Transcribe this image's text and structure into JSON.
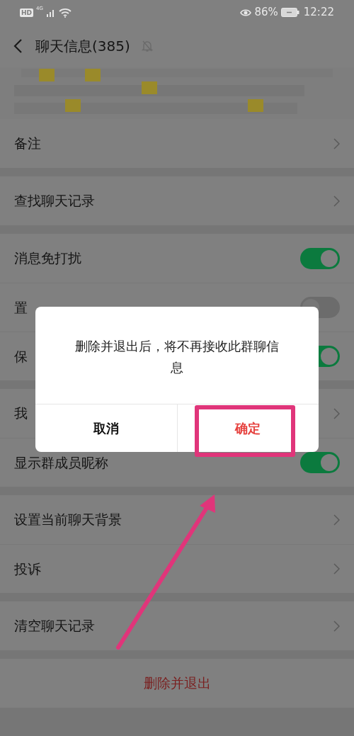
{
  "status_bar": {
    "hd_badge": "HD",
    "network": "4G",
    "battery": "86%",
    "time": "12:22"
  },
  "header": {
    "title": "聊天信息(385)",
    "muted": true
  },
  "members": {
    "kind": "picture"
  },
  "groups": [
    [
      {
        "kind": "link",
        "label": "备注"
      }
    ],
    [
      {
        "kind": "link",
        "label": "查找聊天记录"
      }
    ],
    [
      {
        "kind": "toggle",
        "label": "消息免打扰",
        "on": true
      },
      {
        "kind": "toggle",
        "label": "置",
        "on": false
      },
      {
        "kind": "toggle",
        "label": "保",
        "on": true
      }
    ],
    [
      {
        "kind": "link",
        "label": "我"
      },
      {
        "kind": "toggle",
        "label": "显示群成员昵称",
        "on": true
      }
    ],
    [
      {
        "kind": "link",
        "label": "设置当前聊天背景"
      },
      {
        "kind": "link",
        "label": "投诉"
      }
    ],
    [
      {
        "kind": "link",
        "label": "清空聊天记录"
      }
    ],
    [
      {
        "kind": "danger",
        "label": "删除并退出"
      }
    ]
  ],
  "dialog": {
    "message": "删除并退出后，将不再接收此群聊信息",
    "buttons": [
      {
        "label": "取消",
        "kind": "cancel"
      },
      {
        "label": "确定",
        "kind": "confirm"
      }
    ]
  }
}
